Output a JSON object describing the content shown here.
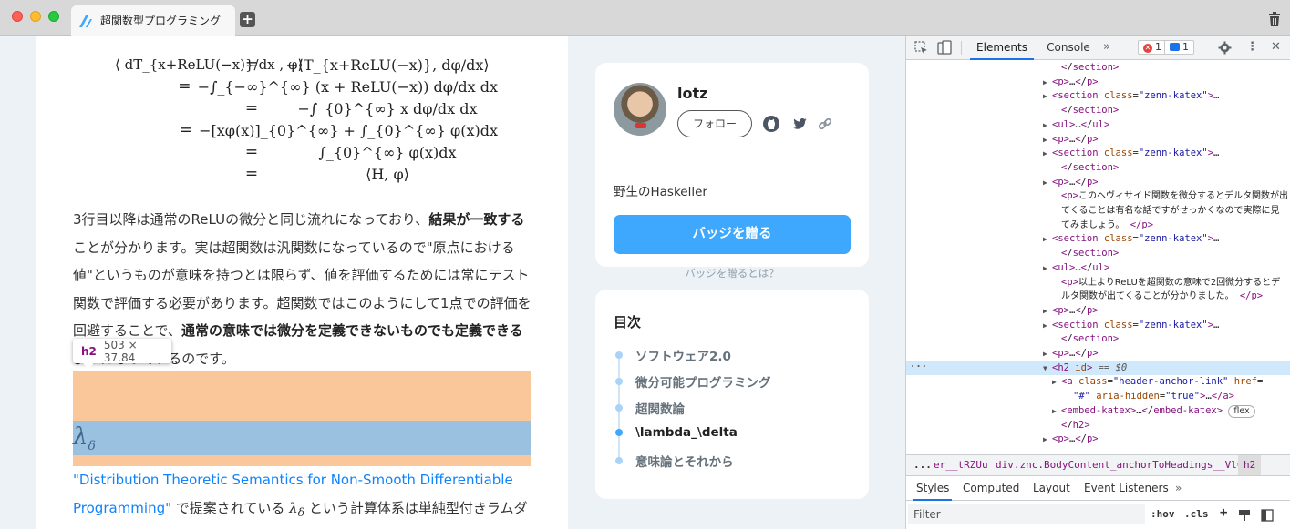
{
  "browser": {
    "tab_title": "超関数型プログラミング",
    "new_tab_label": "+"
  },
  "article": {
    "math": {
      "lhs": "⟨ dT_{x+ReLU(−x)}/dx , φ⟩",
      "rows": [
        "−⟨T_{x+ReLU(−x)}, dφ/dx⟩",
        "−∫_{−∞}^{∞} (x + ReLU(−x)) dφ/dx dx",
        "−∫_{0}^{∞} x dφ/dx dx",
        "−[xφ(x)]_{0}^{∞} + ∫_{0}^{∞} φ(x)dx",
        "∫_{0}^{∞} φ(x)dx",
        "⟨H, φ⟩"
      ],
      "eq": "="
    },
    "para1": {
      "s1": "3行目以降は通常のReLUの微分と同じ流れになっており、",
      "b1": "結果が一致する",
      "s2": " ことが分かります。実は超関数は汎関数になっているので\"原点における値\"というものが意味を持つとは限らず、値を評価するためには常にテスト関数で評価する必要があります。超関数ではこのようにして1点での評価を回避することで、",
      "b2": "通常の意味では微分を定義できないものでも定義できる",
      "s3": " ようになっているのです。"
    },
    "heading_symbol": "λ",
    "heading_sub": "δ",
    "para2": {
      "link": "\"Distribution Theoretic Semantics for Non-Smooth Differentiable Programming\"",
      "s1": " で提案されている ",
      "sym": "λ",
      "sym_sub": "δ",
      "s2": " という計算体系は単純型付きラムダ計算を拡張したものです。"
    },
    "inspect_tooltip": {
      "tag": "h2",
      "dims": "503 × 37.84"
    }
  },
  "profile": {
    "username": "lotz",
    "follow_label": "フォロー",
    "bio": "野生のHaskeller",
    "badge_button": "バッジを贈る",
    "badge_link": "バッジを贈るとは？"
  },
  "toc": {
    "title": "目次",
    "items": [
      {
        "label": "ソフトウェア2.0",
        "active": false
      },
      {
        "label": "微分可能プログラミング",
        "active": false
      },
      {
        "label": "超関数論",
        "active": false
      },
      {
        "label": "\\lambda_\\delta",
        "active": true
      },
      {
        "label": "意味論とそれから",
        "active": false
      }
    ]
  },
  "devtools": {
    "tabs": [
      "Elements",
      "Console"
    ],
    "more": "»",
    "errors": "1",
    "messages": "1",
    "dom": [
      {
        "indent": 2,
        "raw": "</section>",
        "kind": "close"
      },
      {
        "indent": 1,
        "raw": "<p>…</p>",
        "kind": "collapsed"
      },
      {
        "indent": 1,
        "tag": "section",
        "attr": "class",
        "val": "zenn-katex",
        "kind": "open-attr"
      },
      {
        "indent": 2,
        "raw": "</section>",
        "kind": "close"
      },
      {
        "indent": 1,
        "raw": "<ul>…</ul>",
        "kind": "collapsed"
      },
      {
        "indent": 1,
        "raw": "<p>…</p>",
        "kind": "collapsed"
      },
      {
        "indent": 1,
        "tag": "section",
        "attr": "class",
        "val": "zenn-katex",
        "kind": "open-attr"
      },
      {
        "indent": 2,
        "raw": "</section>",
        "kind": "close"
      },
      {
        "indent": 1,
        "raw": "<p>…</p>",
        "kind": "collapsed"
      },
      {
        "indent": 2,
        "text": "このヘヴィサイド関数を微分するとデルタ関数が出",
        "kind": "ptext-start"
      },
      {
        "indent": 2,
        "text": "てくることは有名な話ですがせっかくなので実際に見",
        "kind": "text"
      },
      {
        "indent": 2,
        "text": "てみましょう。",
        "kind": "text-end"
      },
      {
        "indent": 1,
        "tag": "section",
        "attr": "class",
        "val": "zenn-katex",
        "kind": "open-attr"
      },
      {
        "indent": 2,
        "raw": "</section>",
        "kind": "close"
      },
      {
        "indent": 1,
        "raw": "<ul>…</ul>",
        "kind": "collapsed"
      },
      {
        "indent": 2,
        "text": "以上よりReLUを超関数の意味で2回微分するとデ",
        "kind": "ptext-start"
      },
      {
        "indent": 2,
        "text": "ルタ関数が出てくることが分かりました。",
        "kind": "text-end"
      },
      {
        "indent": 1,
        "raw": "<p>…</p>",
        "kind": "collapsed"
      },
      {
        "indent": 1,
        "tag": "section",
        "attr": "class",
        "val": "zenn-katex",
        "kind": "open-attr"
      },
      {
        "indent": 2,
        "raw": "</section>",
        "kind": "close"
      },
      {
        "indent": 1,
        "raw": "<p>…</p>",
        "kind": "collapsed"
      },
      {
        "indent": 1,
        "raw": "<h2 id>",
        "suffix": " == $0",
        "kind": "selected"
      },
      {
        "indent": 2,
        "tag": "a",
        "attr": "class",
        "val": "header-anchor-link",
        "attr2": "href",
        "kind": "anchor"
      },
      {
        "indent": 3,
        "raw": "\"#\" aria-hidden=\"true\">…</a>",
        "kind": "cont"
      },
      {
        "indent": 2,
        "raw": "<embed-katex>…</embed-katex>",
        "pill": "flex",
        "kind": "collapsed-pill"
      },
      {
        "indent": 2,
        "raw": "</h2>",
        "kind": "close"
      },
      {
        "indent": 1,
        "raw": "<p>…</p>",
        "kind": "collapsed"
      }
    ],
    "breadcrumbs": [
      "...",
      "er__tRZUu",
      "div.znc.BodyContent_anchorToHeadings__Vl0_u",
      "h2"
    ],
    "styles_tabs": [
      "Styles",
      "Computed",
      "Layout",
      "Event Listeners"
    ],
    "filter_placeholder": "Filter",
    "filter_tools": [
      ":hov",
      ".cls",
      "+"
    ]
  },
  "colors": {
    "accent": "#3ea8ff",
    "margin_highlight": "#f9c799",
    "content_highlight": "#9ac1e0",
    "link": "#0f83fd"
  }
}
